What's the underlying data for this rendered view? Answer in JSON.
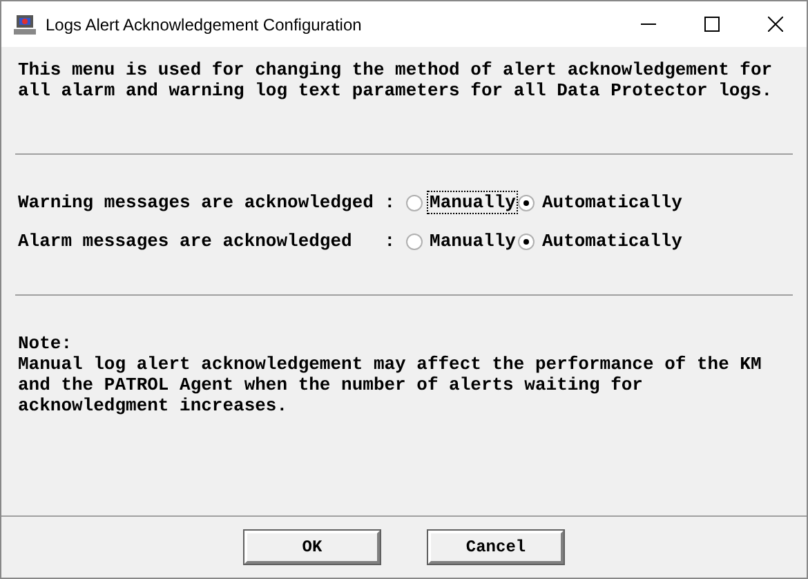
{
  "window": {
    "title": "Logs Alert Acknowledgement Configuration"
  },
  "intro": "This menu is used for changing the method of alert acknowledgement for all alarm and warning log text parameters for all Data Protector logs.",
  "settings": [
    {
      "label": "Warning messages are acknowledged :",
      "options": [
        {
          "label": "Manually",
          "selected": false,
          "focused": true
        },
        {
          "label": "Automatically",
          "selected": true,
          "focused": false
        }
      ]
    },
    {
      "label": "Alarm messages are acknowledged   :",
      "options": [
        {
          "label": "Manually",
          "selected": false,
          "focused": false
        },
        {
          "label": "Automatically",
          "selected": true,
          "focused": false
        }
      ]
    }
  ],
  "note": {
    "heading": "Note:",
    "text": "Manual log alert acknowledgement may affect the performance of the KM and the PATROL Agent when the number of alerts waiting for acknowledgment increases."
  },
  "buttons": [
    "OK",
    "Cancel"
  ]
}
